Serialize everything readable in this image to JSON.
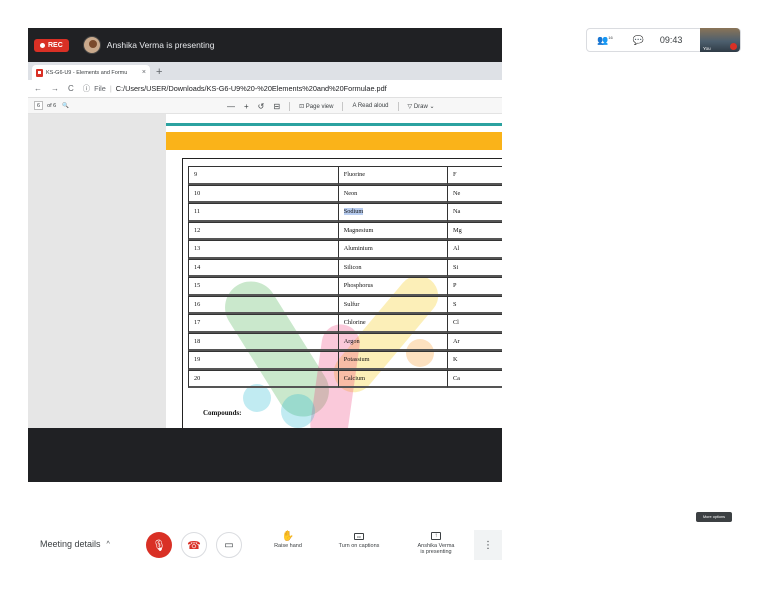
{
  "stage": {
    "rec_label": "REC",
    "presenter_text": "Anshika Verma is presenting"
  },
  "browser": {
    "tab_title": "KS-G6-U9 - Elements and Formu",
    "tab_close": "×",
    "tab_add": "+",
    "nav_back": "←",
    "nav_forward": "→",
    "nav_reload": "C",
    "address_info": "ⓘ",
    "address_file": "File",
    "address_sep": "|",
    "url": "C:/Users/USER/Downloads/KS-G6-U9%20-%20Elements%20and%20Formulae.pdf"
  },
  "pdf_toolbar": {
    "page_number": "6",
    "page_total": "of 6",
    "search_icon": "🔍",
    "zoom_out": "—",
    "zoom_in": "+",
    "rotate": "↺",
    "fit": "⊟",
    "page_view_icon": "⊡",
    "page_view": "Page view",
    "read_aloud_icon": "A",
    "read_aloud": "Read aloud",
    "draw_icon": "▽",
    "draw": "Draw",
    "draw_chevron": "⌄"
  },
  "elements_table": [
    {
      "number": "9",
      "name": "Fluorine",
      "symbol": "F"
    },
    {
      "number": "10",
      "name": "Neon",
      "symbol": "Ne"
    },
    {
      "number": "11",
      "name": "Sodium",
      "symbol": "Na"
    },
    {
      "number": "12",
      "name": "Magnesium",
      "symbol": "Mg"
    },
    {
      "number": "13",
      "name": "Aluminium",
      "symbol": "Al"
    },
    {
      "number": "14",
      "name": "Silicon",
      "symbol": "Si"
    },
    {
      "number": "15",
      "name": "Phosphorus",
      "symbol": "P"
    },
    {
      "number": "16",
      "name": "Sulfur",
      "symbol": "S"
    },
    {
      "number": "17",
      "name": "Chlorine",
      "symbol": "Cl"
    },
    {
      "number": "18",
      "name": "Argon",
      "symbol": "Ar"
    },
    {
      "number": "19",
      "name": "Potassium",
      "symbol": "K"
    },
    {
      "number": "20",
      "name": "Calcium",
      "symbol": "Ca"
    }
  ],
  "highlighted_row_index": 2,
  "compounds_heading": "Compounds:",
  "self_view": {
    "people_icon": "👥",
    "people_count": "16",
    "chat_icon": "💬",
    "time": "09:43",
    "you_label": "You"
  },
  "tooltip": "More options",
  "bottom_bar": {
    "meeting_details": "Meeting details",
    "meeting_details_chevron": "^",
    "mic_icon": "🎙",
    "hangup_icon": "☎",
    "camera_icon": "▭",
    "raise_hand_icon": "✋",
    "raise_hand": "Raise hand",
    "captions_icon": "cc",
    "captions": "Turn on captions",
    "present_icon": "↑",
    "presenting_line1": "Anshika Verma",
    "presenting_line2": "is presenting",
    "more_icon": "⋮"
  },
  "colors": {
    "rec": "#d93025",
    "stage_bg": "#202124",
    "teal_line": "#2ba2a0",
    "orange_band": "#fab319",
    "selection_highlight": "#b8cdf0"
  }
}
